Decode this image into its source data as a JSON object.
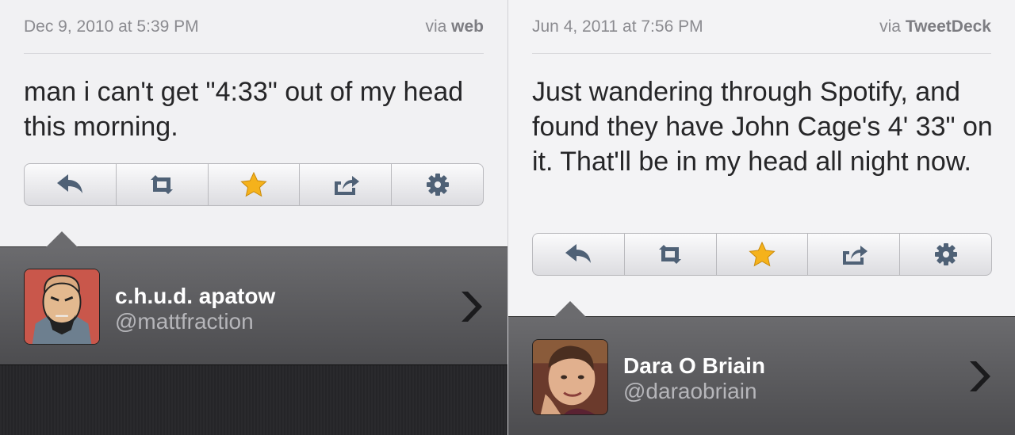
{
  "tweets": [
    {
      "date": "Dec 9, 2010 at 5:39 PM",
      "via_prefix": "via",
      "via_source": "web",
      "text": "man i can't get \"4:33\" out of my head this morning.",
      "user_name": "c.h.u.d. apatow",
      "handle": "@mattfraction"
    },
    {
      "date": "Jun 4, 2011 at 7:56 PM",
      "via_prefix": "via",
      "via_source": "TweetDeck",
      "text": "Just wandering through Spotify, and found they have John Cage's 4' 33\" on it.  That'll be in my head all night now.",
      "user_name": "Dara O Briain",
      "handle": "@daraobriain"
    }
  ],
  "actions": [
    "reply-icon",
    "retweet-icon",
    "favorite-star-icon",
    "share-icon",
    "gear-icon"
  ],
  "colors": {
    "star": "#f5b21b",
    "icon": "#4f6176",
    "userbar": "#5c5c5f"
  }
}
